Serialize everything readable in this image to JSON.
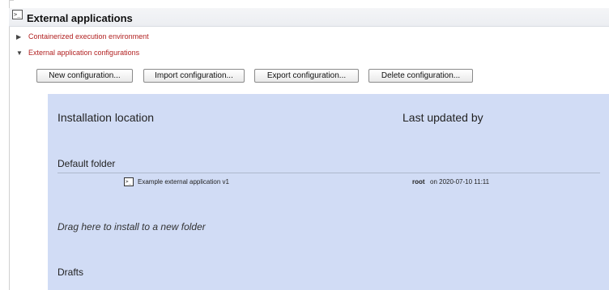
{
  "header": {
    "icon": "terminal-icon",
    "icon_glyph": ">_",
    "title": "External applications"
  },
  "tree": [
    {
      "state": "collapsed",
      "glyph": "▶",
      "label": "Containerized execution environment"
    },
    {
      "state": "expanded",
      "glyph": "▼",
      "label": "External application configurations"
    }
  ],
  "toolbar": {
    "new_label": "New configuration...",
    "import_label": "Import configuration...",
    "export_label": "Export configuration...",
    "delete_label": "Delete configuration..."
  },
  "table": {
    "columns": [
      "Installation location",
      "Last updated by"
    ],
    "folders": [
      {
        "name": "Default folder",
        "items": [
          {
            "icon": "terminal-icon",
            "icon_glyph": ">_",
            "name": "Example external application v1",
            "user": "root",
            "on": " on 2020-07-10 11:11"
          }
        ]
      }
    ],
    "drop_hint": "Drag here to install to a new folder",
    "drafts": "Drafts"
  },
  "colors": {
    "panel_bg": "#d1dcf5",
    "link_red": "#b22222",
    "header_bg": "#eceef2"
  }
}
